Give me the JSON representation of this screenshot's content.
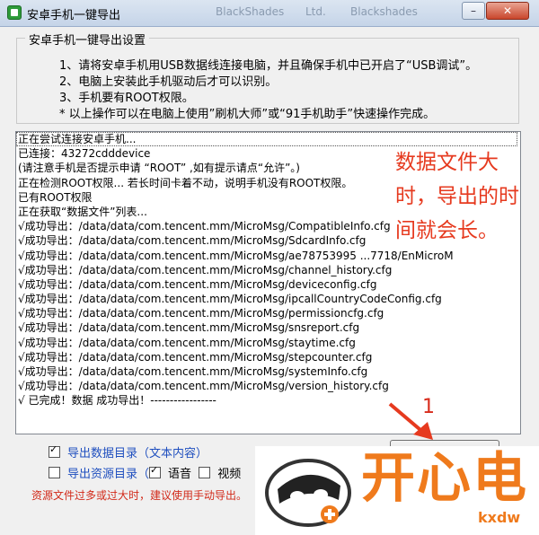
{
  "window": {
    "title": "安卓手机一键导出",
    "ghost_tabs": [
      "BlackShades",
      "Ltd.",
      "Blackshades"
    ],
    "buttons": {
      "minimize": "–",
      "maximize": "□",
      "close": "✕"
    }
  },
  "settings": {
    "group_title": "安卓手机一键导出设置",
    "instructions": [
      "1、请将安卓手机用USB数据线连接电脑，并且确保手机中已开启了“USB调试”。",
      "2、电脑上安装此手机驱动后才可以识别。",
      "3、手机要有ROOT权限。",
      "* 以上操作可以在电脑上使用”刷机大师”或“91手机助手”快速操作完成。"
    ]
  },
  "log": {
    "lines": [
      "正在尝试连接安卓手机...",
      "已连接：43272cdddevice",
      "(请注意手机是否提示申请 “ROOT” ,如有提示请点“允许”。)",
      "正在检测ROOT权限...     若长时间卡着不动，说明手机没有ROOT权限。",
      "已有ROOT权限",
      "正在获取“数据文件”列表...",
      "√成功导出：/data/data/com.tencent.mm/MicroMsg/CompatibleInfo.cfg",
      "√成功导出：/data/data/com.tencent.mm/MicroMsg/SdcardInfo.cfg",
      "√成功导出：/data/data/com.tencent.mm/MicroMsg/ae78753995               ...7718/EnMicroM",
      "√成功导出：/data/data/com.tencent.mm/MicroMsg/channel_history.cfg",
      "√成功导出：/data/data/com.tencent.mm/MicroMsg/deviceconfig.cfg",
      "√成功导出：/data/data/com.tencent.mm/MicroMsg/ipcallCountryCodeConfig.cfg",
      "√成功导出：/data/data/com.tencent.mm/MicroMsg/permissioncfg.cfg",
      "√成功导出：/data/data/com.tencent.mm/MicroMsg/snsreport.cfg",
      "√成功导出：/data/data/com.tencent.mm/MicroMsg/staytime.cfg",
      "√成功导出：/data/data/com.tencent.mm/MicroMsg/stepcounter.cfg",
      "√成功导出：/data/data/com.tencent.mm/MicroMsg/systemInfo.cfg",
      "√成功导出：/data/data/com.tencent.mm/MicroMsg/version_history.cfg",
      "√ 已完成！数据  成功导出！-----------------"
    ]
  },
  "annotation": {
    "note": "数据文件大时，导出的时间就会长。",
    "number": "1",
    "color": "#e63a1f"
  },
  "options": {
    "export_data": {
      "label": "导出数据目录（文本内容）",
      "checked": true
    },
    "export_resources": {
      "label": "导出资源目录（",
      "checked": false
    },
    "voice": {
      "label": "语音",
      "checked": true
    },
    "video": {
      "label": "视频",
      "checked": false
    },
    "warning": "资源文件过多或过大时，建议使用手动导出。"
  },
  "watermark": {
    "text": "开心电",
    "url": "kxdw",
    "color": "#ef7a1c"
  }
}
